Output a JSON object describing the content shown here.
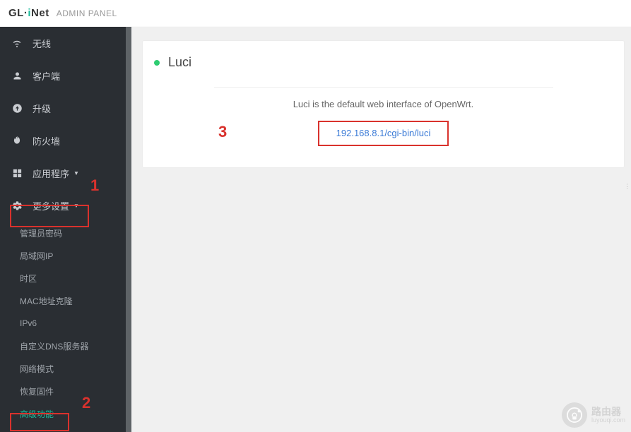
{
  "header": {
    "brand_prefix": "GL",
    "brand_dot": "·",
    "brand_i": "i",
    "brand_suffix": "Net",
    "panel_label": "ADMIN PANEL"
  },
  "sidebar": {
    "items": [
      {
        "label": "无线",
        "icon": "wifi-icon",
        "has_caret": false
      },
      {
        "label": "客户端",
        "icon": "user-icon",
        "has_caret": false
      },
      {
        "label": "升级",
        "icon": "upgrade-icon",
        "has_caret": false
      },
      {
        "label": "防火墙",
        "icon": "firewall-icon",
        "has_caret": false
      },
      {
        "label": "应用程序",
        "icon": "apps-icon",
        "has_caret": true
      },
      {
        "label": "更多设置",
        "icon": "gear-icon",
        "has_caret": true
      }
    ],
    "sub_items": [
      {
        "label": "管理员密码",
        "active": false
      },
      {
        "label": "局域网IP",
        "active": false
      },
      {
        "label": "时区",
        "active": false
      },
      {
        "label": "MAC地址克隆",
        "active": false
      },
      {
        "label": "IPv6",
        "active": false
      },
      {
        "label": "自定义DNS服务器",
        "active": false
      },
      {
        "label": "网络模式",
        "active": false
      },
      {
        "label": "恢复固件",
        "active": false
      },
      {
        "label": "高级功能",
        "active": true
      }
    ]
  },
  "main": {
    "card_title": "Luci",
    "description": "Luci is the default web interface of OpenWrt.",
    "link_text": "192.168.8.1/cgi-bin/luci"
  },
  "annotations": {
    "a1": "1",
    "a2": "2",
    "a3": "3"
  },
  "watermark": {
    "line1": "路由器",
    "line2": "luyouqi.com"
  }
}
